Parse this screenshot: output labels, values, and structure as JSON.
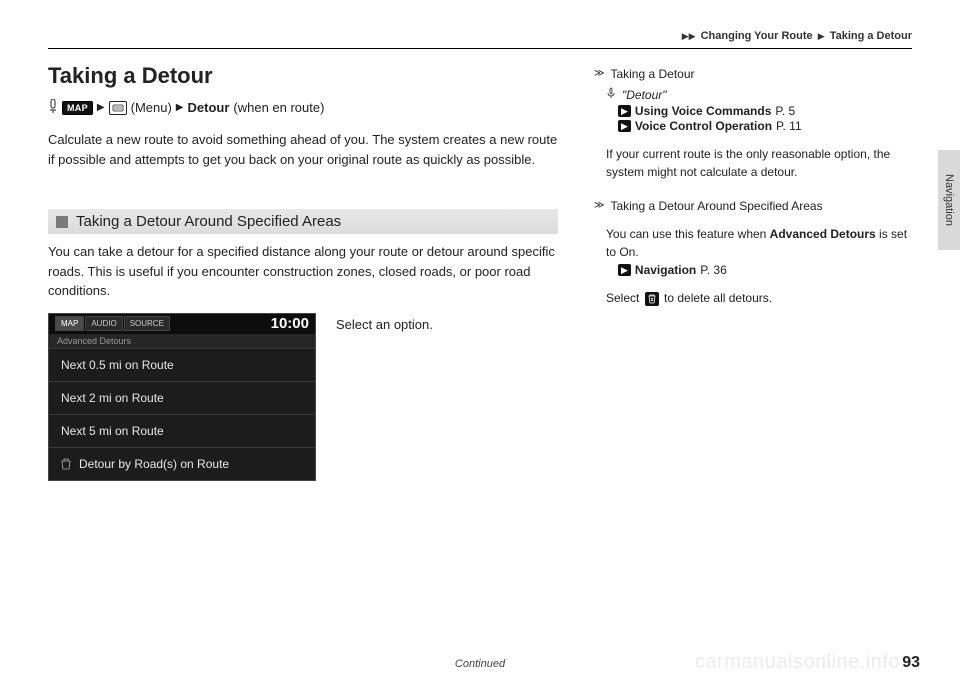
{
  "breadcrumb": {
    "arrow": "▶▶",
    "section": "Changing Your Route",
    "sep": "▶",
    "page": "Taking a Detour"
  },
  "title": "Taking a Detour",
  "path": {
    "map_btn": "MAP",
    "menu_text": "(Menu)",
    "detour": "Detour",
    "paren": "(when en route)"
  },
  "main_para": "Calculate a new route to avoid something ahead of you. The system creates a new route if possible and attempts to get you back on your original route as quickly as possible.",
  "subheader": "Taking a Detour Around Specified Areas",
  "sub_para": "You can take a detour for a specified distance along your route or detour around specific roads. This is useful if you encounter construction zones, closed roads, or poor road conditions.",
  "screenshot": {
    "tabs": [
      "MAP",
      "AUDIO",
      "SOURCE"
    ],
    "clock": "10:00",
    "subtitle": "Advanced Detours",
    "items": [
      "Next 0.5 mi on Route",
      "Next 2 mi on Route",
      "Next 5 mi on Route",
      "Detour by Road(s) on Route"
    ]
  },
  "right_caption": "Select an option.",
  "side_tab": "Navigation",
  "notes": {
    "n1": {
      "title": "Taking a Detour",
      "voice": "\"Detour\"",
      "refs": [
        {
          "label": "Using Voice Commands",
          "pg": "P. 5"
        },
        {
          "label": "Voice Control Operation",
          "pg": "P. 11"
        }
      ],
      "para": "If your current route is the only reasonable option, the system might not calculate a detour."
    },
    "n2": {
      "title": "Taking a Detour Around Specified Areas",
      "para_pre": "You can use this feature when ",
      "para_bold": "Advanced Detours",
      "para_post": " is set to On.",
      "ref": {
        "label": "Navigation",
        "pg": "P. 36"
      },
      "select_pre": "Select ",
      "select_post": " to delete all detours."
    }
  },
  "footer": {
    "continued": "Continued",
    "page_num": "93",
    "watermark": "carmanualsonline.info"
  }
}
